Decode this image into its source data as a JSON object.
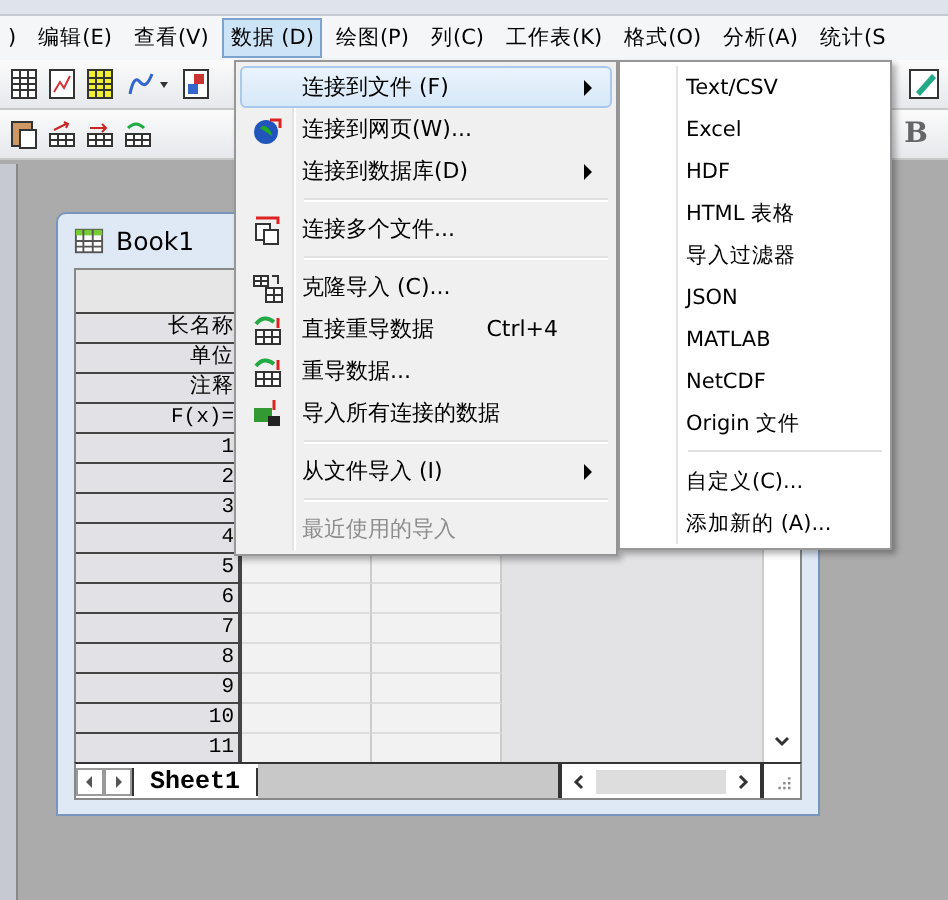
{
  "menu_bar": [
    {
      "label": ")",
      "selected": false
    },
    {
      "label": "编辑(E)",
      "selected": false
    },
    {
      "label": "查看(V)",
      "selected": false
    },
    {
      "label": "数据 (D)",
      "selected": true
    },
    {
      "label": "绘图(P)",
      "selected": false
    },
    {
      "label": "列(C)",
      "selected": false
    },
    {
      "label": "工作表(K)",
      "selected": false
    },
    {
      "label": "格式(O)",
      "selected": false
    },
    {
      "label": "分析(A)",
      "selected": false
    },
    {
      "label": "统计(S",
      "selected": false
    }
  ],
  "toolbar": {
    "bold_button": "B"
  },
  "data_menu": [
    {
      "kind": "item",
      "label": "连接到文件 (F)",
      "selected": true,
      "submenu": true,
      "icon": false,
      "disabled": false
    },
    {
      "kind": "item",
      "label": "连接到网页(W)...",
      "selected": false,
      "submenu": false,
      "icon": true,
      "disabled": false
    },
    {
      "kind": "item",
      "label": "连接到数据库(D)",
      "selected": false,
      "submenu": true,
      "icon": false,
      "disabled": false
    },
    {
      "kind": "separator"
    },
    {
      "kind": "item",
      "label": "连接多个文件...",
      "selected": false,
      "submenu": false,
      "icon": true,
      "disabled": false
    },
    {
      "kind": "separator"
    },
    {
      "kind": "item",
      "label": "克隆导入 (C)...",
      "selected": false,
      "submenu": false,
      "icon": true,
      "disabled": false
    },
    {
      "kind": "item",
      "label": "直接重导数据",
      "shortcut": "Ctrl+4",
      "selected": false,
      "submenu": false,
      "icon": true,
      "disabled": false
    },
    {
      "kind": "item",
      "label": "重导数据...",
      "selected": false,
      "submenu": false,
      "icon": true,
      "disabled": false
    },
    {
      "kind": "item",
      "label": "导入所有连接的数据",
      "selected": false,
      "submenu": false,
      "icon": true,
      "disabled": false
    },
    {
      "kind": "separator"
    },
    {
      "kind": "item",
      "label": "从文件导入 (I)",
      "selected": false,
      "submenu": true,
      "icon": false,
      "disabled": false
    },
    {
      "kind": "separator"
    },
    {
      "kind": "item",
      "label": "最近使用的导入",
      "selected": false,
      "submenu": false,
      "icon": false,
      "disabled": true
    }
  ],
  "file_submenu": [
    {
      "kind": "item",
      "label": "Text/CSV"
    },
    {
      "kind": "item",
      "label": "Excel"
    },
    {
      "kind": "item",
      "label": "HDF"
    },
    {
      "kind": "item",
      "label": "HTML 表格"
    },
    {
      "kind": "item",
      "label": "导入过滤器"
    },
    {
      "kind": "item",
      "label": "JSON"
    },
    {
      "kind": "item",
      "label": "MATLAB"
    },
    {
      "kind": "item",
      "label": "NetCDF"
    },
    {
      "kind": "item",
      "label": "Origin 文件"
    },
    {
      "kind": "separator"
    },
    {
      "kind": "item",
      "label": "自定义(C)..."
    },
    {
      "kind": "item",
      "label": "添加新的 (A)..."
    }
  ],
  "workbook": {
    "title": "Book1",
    "row_headers": [
      "长名称",
      "单位",
      "注释",
      "F(x)=",
      "1",
      "2",
      "3",
      "4",
      "5",
      "6",
      "7",
      "8",
      "9",
      "10",
      "11"
    ],
    "sheet_tab": "Sheet1"
  }
}
